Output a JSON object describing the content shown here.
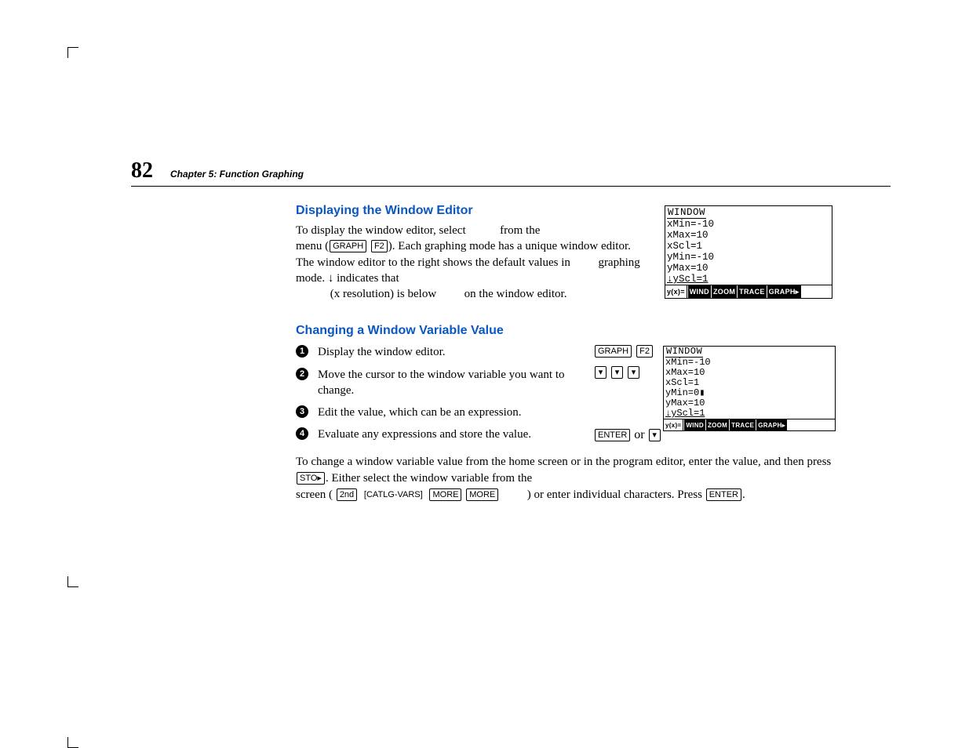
{
  "page": {
    "number": "82",
    "chapter": "Chapter 5:  Function Graphing"
  },
  "section1": {
    "heading": "Displaying the Window Editor",
    "para": {
      "t1": "To display the window editor, select",
      "t2": "from the",
      "t3": "menu (",
      "t4": "). Each graphing mode has a unique window editor. The window editor to the right shows the default values in",
      "t5": "graphing mode. ↓ indicates that",
      "t6": "(x resolution) is below",
      "t7": "on the window editor."
    }
  },
  "keys": {
    "graph": "GRAPH",
    "f2": "F2",
    "enter": "ENTER",
    "sto": "STO▸",
    "second": "2nd",
    "catlg": "CATLG-VARS",
    "more": "MORE",
    "down": "▾"
  },
  "screen1": {
    "title": "WINDOW",
    "l1": " xMin=-10",
    "l2": " xMax=10",
    "l3": " xScl=1",
    "l4": " yMin=-10",
    "l5": " yMax=10",
    "l6": "↓yScl=1",
    "menu": [
      "y(x)=",
      "WIND",
      "ZOOM",
      "TRACE",
      "GRAPH▸"
    ]
  },
  "screen2": {
    "title": "WINDOW",
    "l1": " xMin=-10",
    "l2": " xMax=10",
    "l3": " xScl=1",
    "l4": " yMin=0▮",
    "l5": " yMax=10",
    "l6": "↓yScl=1",
    "menu": [
      "y(x)=",
      "WIND",
      "ZOOM",
      "TRACE",
      "GRAPH▸"
    ]
  },
  "section2": {
    "heading": "Changing a Window Variable Value",
    "steps": {
      "s1": "Display the window editor.",
      "s2": "Move the cursor to the window variable you want to change.",
      "s3": "Edit the value, which can be an expression.",
      "s4": "Evaluate any expressions and store the value."
    },
    "stepkey4_or": " or "
  },
  "bottom": {
    "t1": "To change a window variable value from the home screen or in the program editor, enter the value, and then  press ",
    "t2": ". Either select the window variable from the",
    "t3": "screen ( ",
    "t4": ") or enter individual characters. Press ",
    "t5": "."
  }
}
